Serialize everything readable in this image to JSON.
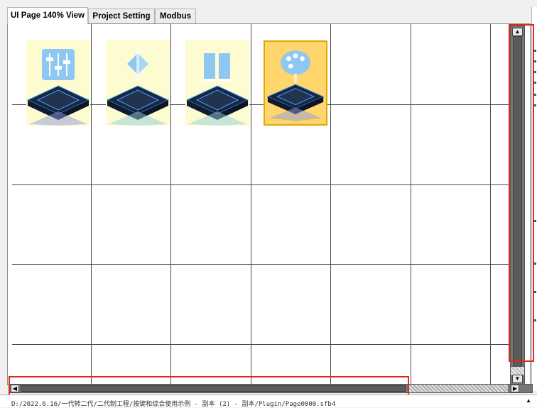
{
  "tabs": [
    {
      "label": "UI Page 140% View",
      "active": true
    },
    {
      "label": "Project Setting",
      "active": false
    },
    {
      "label": "Modbus",
      "active": false
    }
  ],
  "grid_icons": [
    {
      "name": "equalizer-sliders-icon",
      "selected": false
    },
    {
      "name": "diamond-arrows-icon",
      "selected": false
    },
    {
      "name": "bar-blocks-icon",
      "selected": false
    },
    {
      "name": "palette-icon",
      "selected": true
    }
  ],
  "colors": {
    "accent_red": "#e0281e",
    "selected_fill": "#ffd66b",
    "selected_border": "#e8a400",
    "icon_bg": "#fdfbd0",
    "icon_blue": "#8ec7f2",
    "platform_dark": "#1b2540",
    "platform_glow": "#3aa6ff"
  },
  "status_bar": {
    "path": "D:/2022.6.16/一代转二代/二代制工程/按键和综合使用示例 - 副本 (2) - 副本/Plugin/Page0000.sfb4"
  }
}
